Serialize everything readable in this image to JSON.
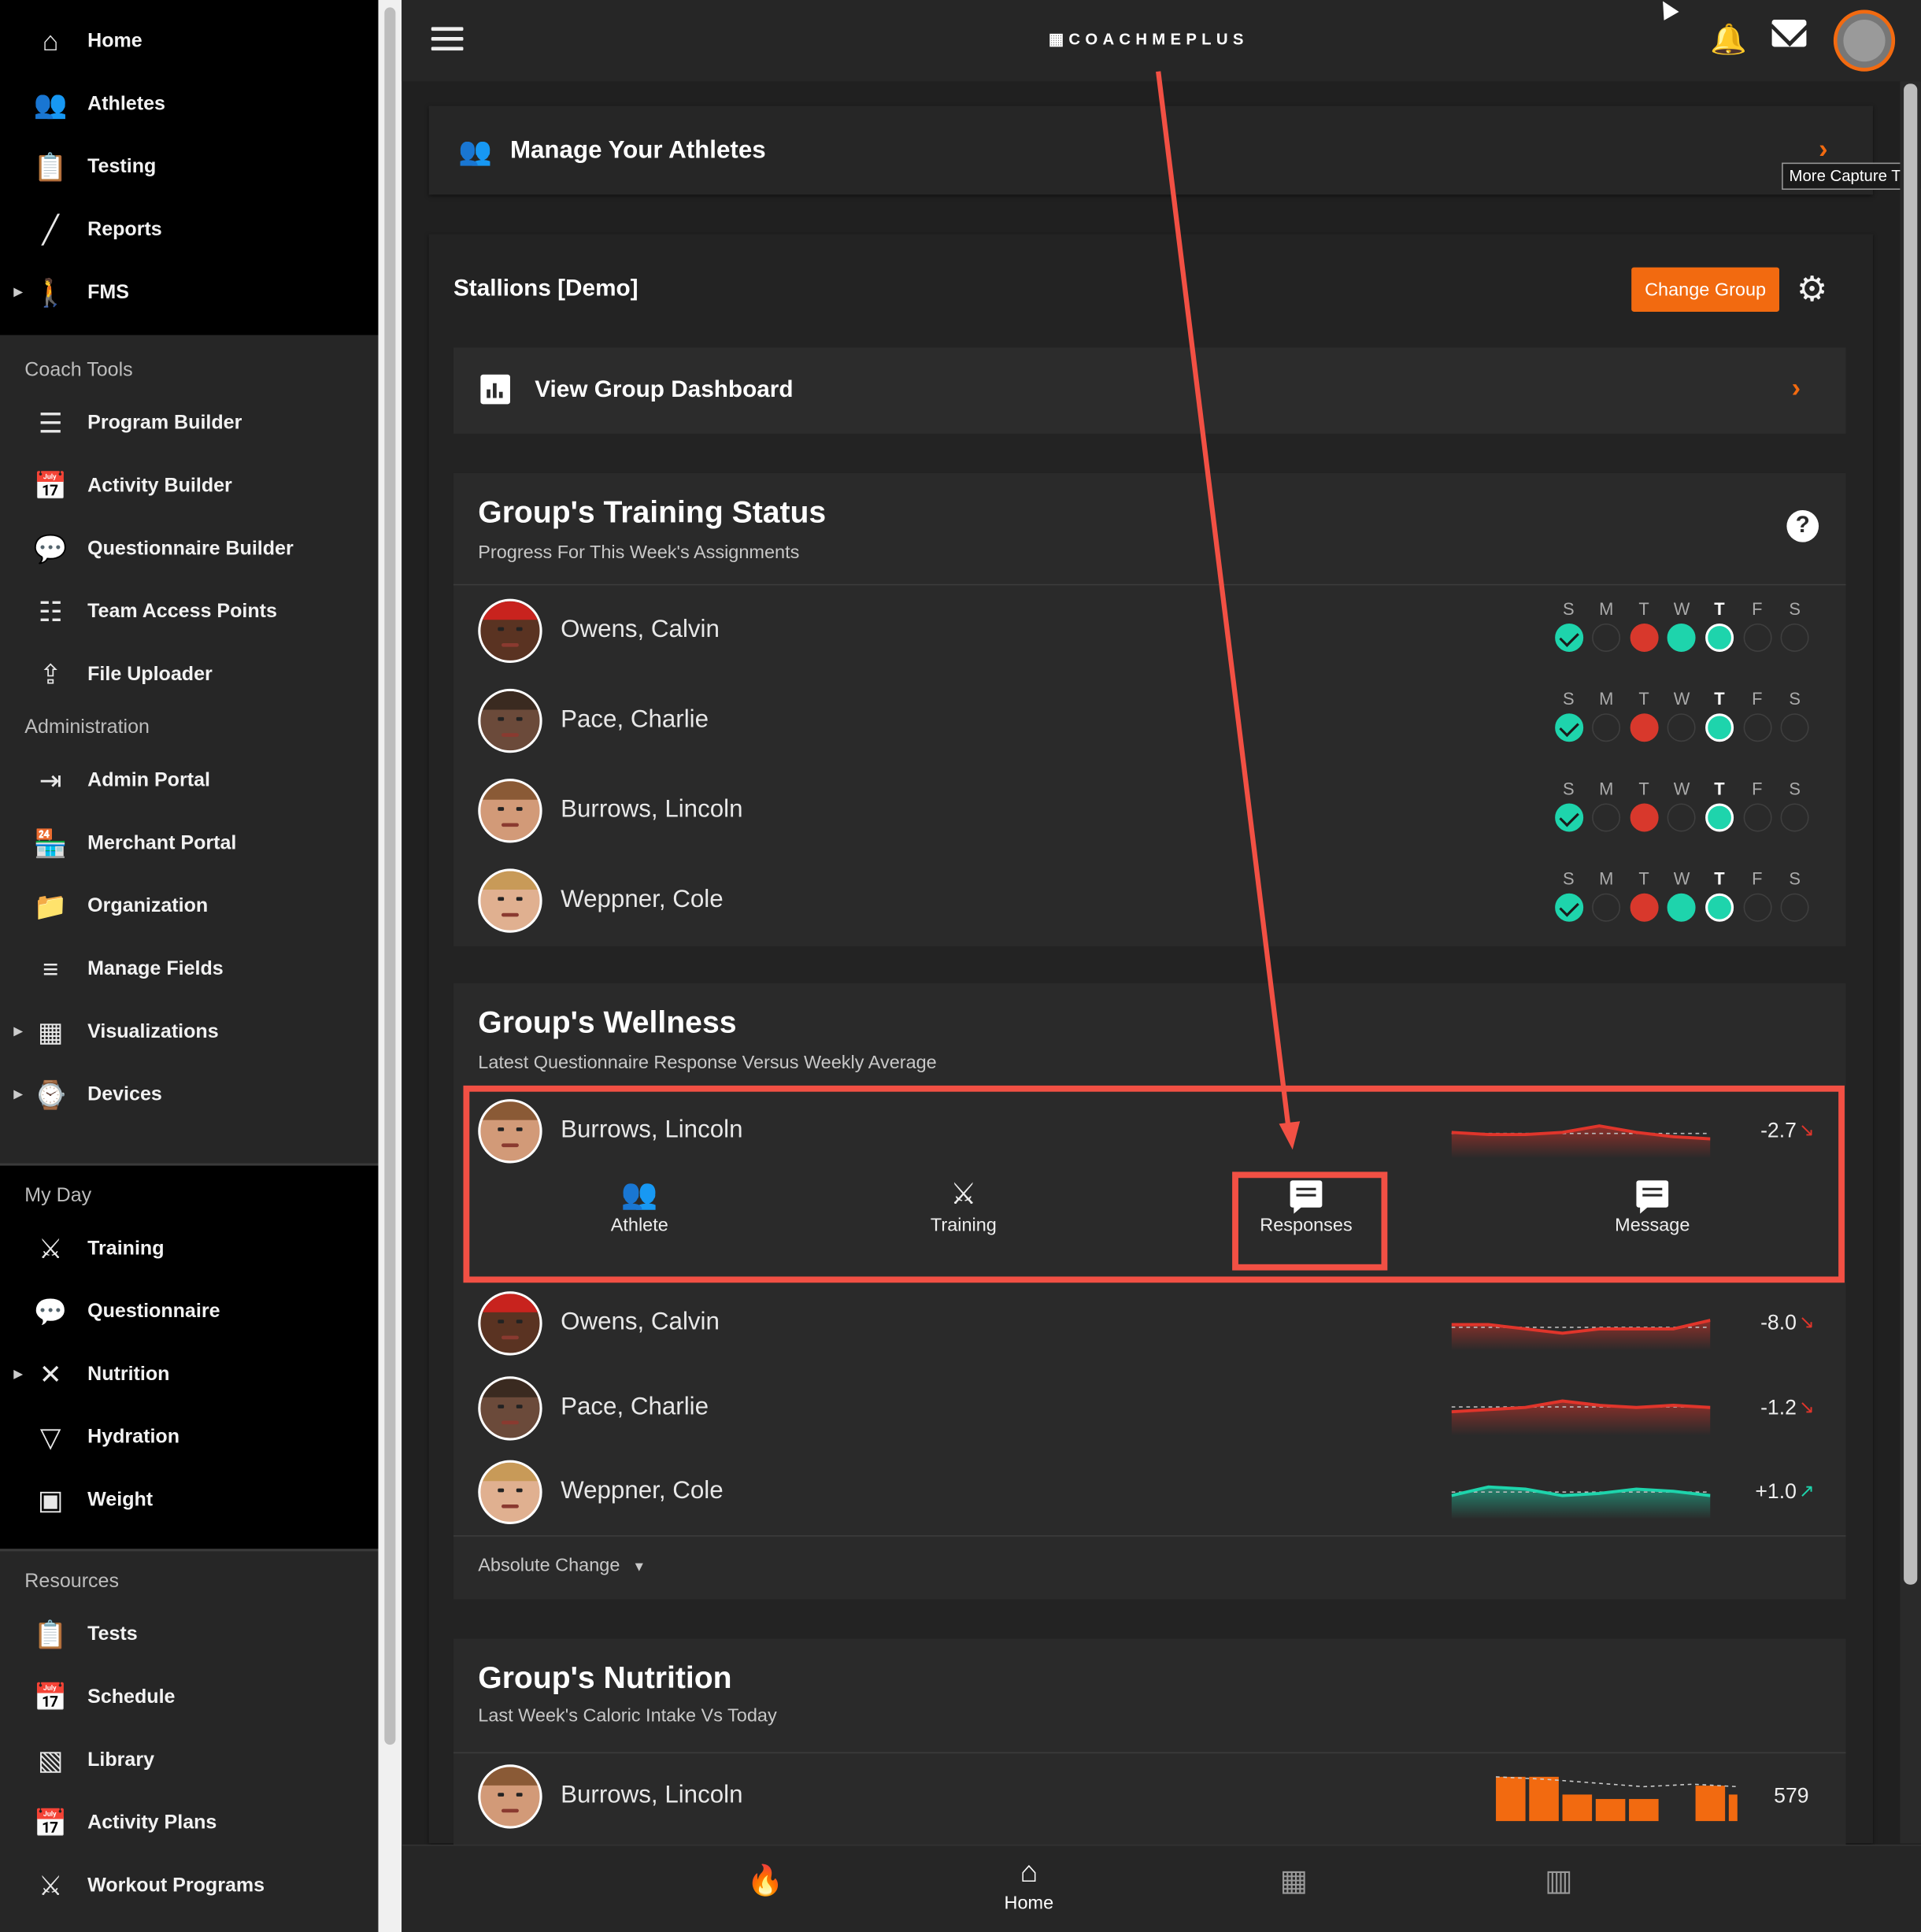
{
  "sidebar": {
    "main_items": [
      {
        "label": "Home",
        "icon": "home-icon"
      },
      {
        "label": "Athletes",
        "icon": "people-icon"
      },
      {
        "label": "Testing",
        "icon": "clipboard-icon"
      },
      {
        "label": "Reports",
        "icon": "line-chart-icon"
      },
      {
        "label": "FMS",
        "icon": "figure-icon",
        "expandable": true
      }
    ],
    "coach_tools_header": "Coach Tools",
    "coach_tools": [
      {
        "label": "Program Builder",
        "icon": "list-icon"
      },
      {
        "label": "Activity Builder",
        "icon": "calendar-icon"
      },
      {
        "label": "Questionnaire Builder",
        "icon": "comment-icon"
      },
      {
        "label": "Team Access Points",
        "icon": "grid-icon"
      },
      {
        "label": "File Uploader",
        "icon": "upload-icon"
      }
    ],
    "administration_header": "Administration",
    "administration": [
      {
        "label": "Admin Portal",
        "icon": "login-icon"
      },
      {
        "label": "Merchant Portal",
        "icon": "store-icon"
      },
      {
        "label": "Organization",
        "icon": "folder-account-icon"
      },
      {
        "label": "Manage Fields",
        "icon": "fields-icon"
      },
      {
        "label": "Visualizations",
        "icon": "dashboard-icon",
        "expandable": true
      },
      {
        "label": "Devices",
        "icon": "watch-icon",
        "expandable": true
      }
    ],
    "my_day_header": "My Day",
    "my_day": [
      {
        "label": "Training",
        "icon": "dumbbell-icon"
      },
      {
        "label": "Questionnaire",
        "icon": "comment-icon"
      },
      {
        "label": "Nutrition",
        "icon": "utensils-icon",
        "expandable": true
      },
      {
        "label": "Hydration",
        "icon": "cup-icon"
      },
      {
        "label": "Weight",
        "icon": "scale-icon"
      }
    ],
    "resources_header": "Resources",
    "resources": [
      {
        "label": "Tests",
        "icon": "clipboard-icon"
      },
      {
        "label": "Schedule",
        "icon": "calendar-icon"
      },
      {
        "label": "Library",
        "icon": "image-library-icon"
      },
      {
        "label": "Activity Plans",
        "icon": "calendar-icon"
      },
      {
        "label": "Workout Programs",
        "icon": "dumbbell-icon"
      }
    ]
  },
  "header": {
    "logo_text": "COACHMEPLUS"
  },
  "manage_card": {
    "label": "Manage Your Athletes",
    "tooltip": "More Capture Ty"
  },
  "group": {
    "name": "Stallions [Demo]",
    "change_button": "Change Group",
    "dashboard_label": "View Group Dashboard"
  },
  "training_status": {
    "title": "Group's Training Status",
    "subtitle": "Progress For This Week's Assignments",
    "day_letters": [
      "S",
      "M",
      "T",
      "W",
      "T",
      "F",
      "S"
    ],
    "today_index": 4,
    "athletes": [
      {
        "name": "Owens, Calvin",
        "days": [
          "done",
          "none",
          "missed",
          "done",
          "today",
          "none",
          "none"
        ],
        "face": "dark-headband"
      },
      {
        "name": "Pace, Charlie",
        "days": [
          "done",
          "none",
          "missed",
          "none",
          "today",
          "none",
          "none"
        ],
        "face": "dark"
      },
      {
        "name": "Burrows, Lincoln",
        "days": [
          "done",
          "none",
          "missed",
          "none",
          "today",
          "none",
          "none"
        ],
        "face": "light"
      },
      {
        "name": "Weppner, Cole",
        "days": [
          "done",
          "none",
          "missed",
          "done",
          "today",
          "none",
          "none"
        ],
        "face": "fair"
      }
    ]
  },
  "wellness": {
    "title": "Group's Wellness",
    "subtitle": "Latest Questionnaire Response Versus Weekly Average",
    "athletes": [
      {
        "name": "Burrows, Lincoln",
        "value": "-2.7",
        "trend": "down",
        "color": "#e0352b",
        "face": "light",
        "spark": [
          6,
          5,
          5,
          6,
          9,
          6,
          4,
          3
        ]
      },
      {
        "name": "Owens, Calvin",
        "value": "-8.0",
        "trend": "down",
        "color": "#e0352b",
        "face": "dark-headband",
        "spark": [
          6,
          6,
          4,
          2,
          4,
          4,
          4,
          8
        ]
      },
      {
        "name": "Pace, Charlie",
        "value": "-1.2",
        "trend": "down",
        "color": "#e0352b",
        "face": "dark",
        "spark": [
          5,
          6,
          7,
          10,
          8,
          7,
          8,
          7
        ]
      },
      {
        "name": "Weppner, Cole",
        "value": "+1.0",
        "trend": "up",
        "color": "#1ed4ac",
        "face": "fair",
        "spark": [
          5,
          9,
          8,
          5,
          6,
          8,
          7,
          5
        ]
      }
    ],
    "actions": [
      {
        "label": "Athlete",
        "icon": "people-icon"
      },
      {
        "label": "Training",
        "icon": "dumbbell-icon"
      },
      {
        "label": "Responses",
        "icon": "comment-icon"
      },
      {
        "label": "Message",
        "icon": "message-icon"
      }
    ],
    "dropdown": "Absolute Change"
  },
  "nutrition": {
    "title": "Group's Nutrition",
    "subtitle": "Last Week's Caloric Intake Vs Today",
    "athletes": [
      {
        "name": "Burrows, Lincoln",
        "value": "579",
        "face": "light",
        "bars": [
          10,
          10,
          6,
          5,
          5,
          0,
          8,
          6
        ]
      }
    ]
  },
  "bottom_nav": [
    {
      "label": "",
      "icon": "flame-icon"
    },
    {
      "label": "Home",
      "icon": "home-icon"
    },
    {
      "label": "",
      "icon": "dashboard-icon"
    },
    {
      "label": "",
      "icon": "bar-chart-icon"
    }
  ],
  "colors": {
    "accent": "#f26a10",
    "success": "#1ed4ac",
    "danger": "#d8382c",
    "highlight": "#f25044"
  }
}
